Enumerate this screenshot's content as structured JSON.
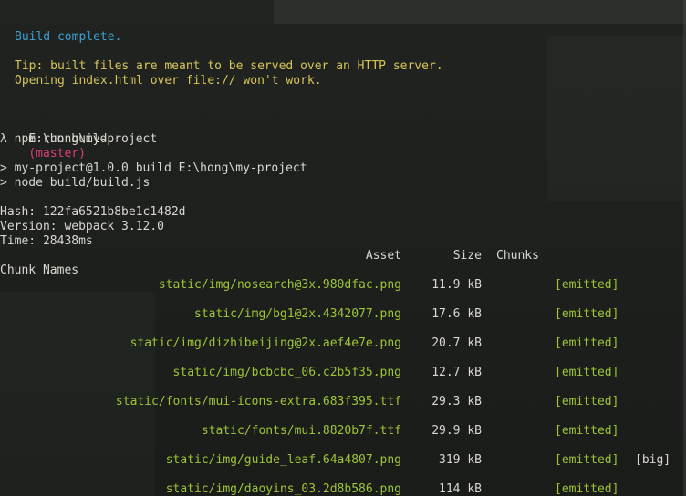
{
  "terminal": {
    "build_complete": "Build complete.",
    "tip_line1": "Tip: built files are meant to be served over an HTTP server.",
    "tip_line2": "Opening index.html over file:// won't work.",
    "cwd": "E:\\hong\\my-project",
    "branch": "(master)",
    "prompt_command": "λ npm run build",
    "script_line1": "> my-project@1.0.0 build E:\\hong\\my-project",
    "script_line2": "> node build/build.js",
    "hash": "Hash: 122fa6521b8be1c1482d",
    "version": "Version: webpack 3.12.0",
    "time": "Time: 28438ms"
  },
  "table": {
    "headers": {
      "asset": "Asset",
      "size": "Size",
      "chunks": "Chunks",
      "chunk_names": "Chunk Names"
    },
    "rows": [
      {
        "asset": "static/img/nosearch@3x.980dfac.png",
        "size": "11.9 kB",
        "status": "[emitted]",
        "flag": ""
      },
      {
        "asset": "static/img/bg1@2x.4342077.png",
        "size": "17.6 kB",
        "status": "[emitted]",
        "flag": ""
      },
      {
        "asset": "static/img/dizhibeijing@2x.aef4e7e.png",
        "size": "20.7 kB",
        "status": "[emitted]",
        "flag": ""
      },
      {
        "asset": "static/img/bcbcbc_06.c2b5f35.png",
        "size": "12.7 kB",
        "status": "[emitted]",
        "flag": ""
      },
      {
        "asset": "static/fonts/mui-icons-extra.683f395.ttf",
        "size": "29.3 kB",
        "status": "[emitted]",
        "flag": ""
      },
      {
        "asset": "static/fonts/mui.8820b7f.ttf",
        "size": "29.9 kB",
        "status": "[emitted]",
        "flag": ""
      },
      {
        "asset": "static/img/guide_leaf.64a4807.png",
        "size": "319 kB",
        "status": "[emitted]",
        "flag": "[big]"
      },
      {
        "asset": "static/img/daoyins_03.2d8b586.png",
        "size": "114 kB",
        "status": "[emitted]",
        "flag": ""
      }
    ]
  },
  "colors": {
    "background": "#1e201e",
    "info": "#3b9fd1",
    "tip": "#d7c55a",
    "branch": "#dd3d7a",
    "asset": "#9dc534",
    "text": "#d8d8d0"
  }
}
